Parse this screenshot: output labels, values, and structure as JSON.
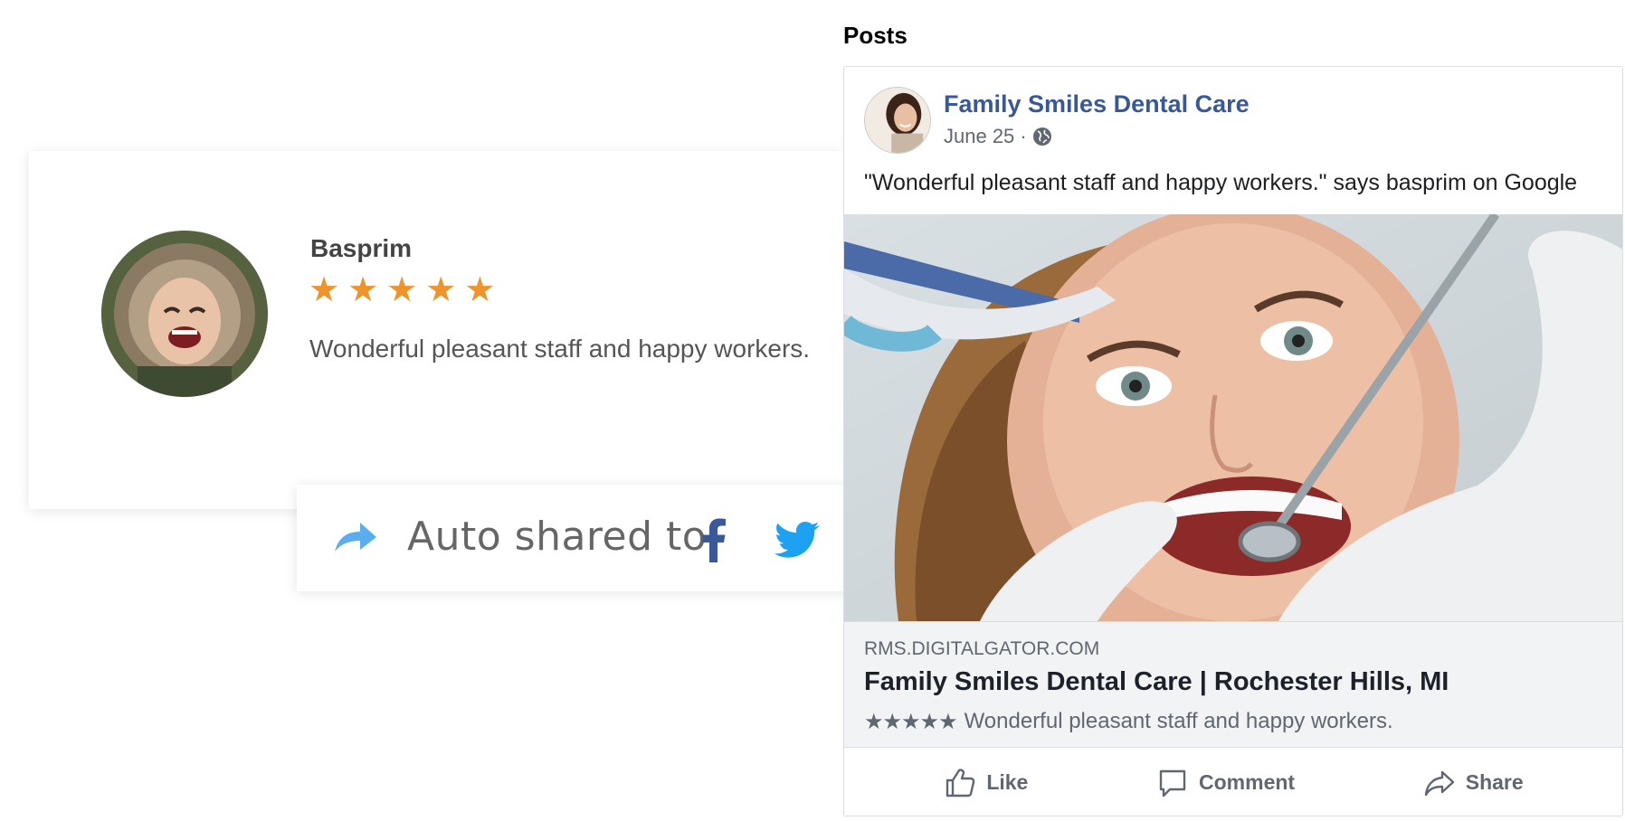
{
  "review": {
    "name": "Basprim",
    "stars": [
      "★",
      "★",
      "★",
      "★",
      "★"
    ],
    "text": "Wonderful pleasant staff and happy workers."
  },
  "share_bar": {
    "label": "Auto shared to",
    "icons": [
      "share-arrow-icon",
      "facebook-icon",
      "twitter-icon"
    ]
  },
  "posts": {
    "heading": "Posts",
    "page_name": "Family Smiles Dental Care",
    "date": "June 25 ·",
    "post_text": "\"Wonderful pleasant staff and happy workers.\" says basprim on Google",
    "link": {
      "domain": "RMS.DIGITALGATOR.COM",
      "title": "Family Smiles Dental Care | Rochester Hills, MI",
      "stars": "★★★★★",
      "description": "Wonderful pleasant staff and happy workers."
    },
    "actions": {
      "like": "Like",
      "comment": "Comment",
      "share": "Share"
    }
  },
  "colors": {
    "star_orange": "#f0932b",
    "facebook_blue": "#3b5998",
    "twitter_blue": "#1da1f2",
    "share_arrow": "#5aaef0",
    "page_link": "#385898"
  }
}
